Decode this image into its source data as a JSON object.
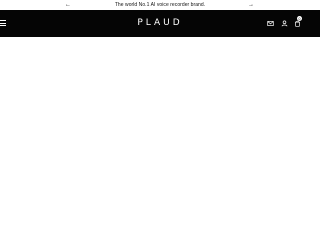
{
  "announcement": {
    "text": "The world No.1 AI voice recorder brand.",
    "prev_arrow": "←",
    "next_arrow": "→"
  },
  "header": {
    "menu_icon": "hamburger-menu-icon",
    "logo_text": "PLAUD",
    "icons": {
      "mail": "mail-icon",
      "account": "user-icon",
      "cart": "cart-icon"
    },
    "cart_count": "0"
  },
  "colors": {
    "header_bg": "#050505",
    "announcement_bg": "#ffffff",
    "page_bg": "#ffffff",
    "header_fg": "#ffffff"
  }
}
